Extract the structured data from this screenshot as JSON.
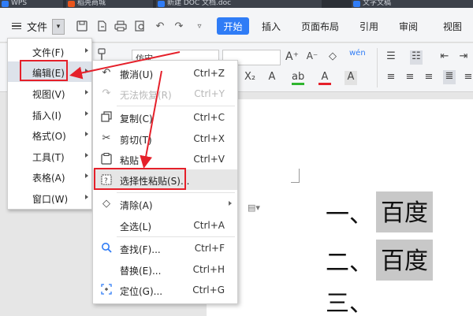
{
  "titlebar": {
    "tabs": [
      "WPS",
      "稻壳商城",
      "新建 DOC 文档.doc",
      "文字文稿"
    ]
  },
  "toolbar": {
    "file_label": "文件",
    "start_tab": "开始",
    "tabs": [
      "插入",
      "页面布局",
      "引用",
      "审阅",
      "视图"
    ]
  },
  "ribbon": {
    "font_name": "仿宋"
  },
  "file_menu": {
    "items": [
      {
        "label": "文件(F)",
        "has_arrow": true
      },
      {
        "label": "编辑(E)",
        "has_arrow": true
      },
      {
        "label": "视图(V)",
        "has_arrow": true
      },
      {
        "label": "插入(I)",
        "has_arrow": true
      },
      {
        "label": "格式(O)",
        "has_arrow": true
      },
      {
        "label": "工具(T)",
        "has_arrow": true
      },
      {
        "label": "表格(A)",
        "has_arrow": true
      },
      {
        "label": "窗口(W)",
        "has_arrow": true
      }
    ]
  },
  "edit_menu": {
    "items": [
      {
        "icon": "undo-icon",
        "label": "撤消(U)",
        "shortcut": "Ctrl+Z",
        "disabled": false
      },
      {
        "icon": "redo-icon",
        "label": "无法恢复(R)",
        "shortcut": "Ctrl+Y",
        "disabled": true
      },
      {
        "icon": "copy-icon",
        "label": "复制(C)",
        "shortcut": "Ctrl+C",
        "disabled": false
      },
      {
        "icon": "cut-icon",
        "label": "剪切(T)",
        "shortcut": "Ctrl+X",
        "disabled": false
      },
      {
        "icon": "paste-icon",
        "label": "粘贴",
        "shortcut": "Ctrl+V",
        "disabled": false
      },
      {
        "icon": "paste-special-icon",
        "label": "选择性粘贴(S)...",
        "shortcut": "",
        "disabled": false
      },
      {
        "icon": "eraser-icon",
        "label": "清除(A)",
        "shortcut": "",
        "disabled": false
      },
      {
        "icon": "",
        "label": "全选(L)",
        "shortcut": "Ctrl+A",
        "disabled": false
      },
      {
        "icon": "search-icon",
        "label": "查找(F)...",
        "shortcut": "Ctrl+F",
        "disabled": false
      },
      {
        "icon": "",
        "label": "替换(E)...",
        "shortcut": "Ctrl+H",
        "disabled": false
      },
      {
        "icon": "locate-icon",
        "label": "定位(G)...",
        "shortcut": "Ctrl+G",
        "disabled": false
      }
    ]
  },
  "document": {
    "lines": [
      {
        "number": "一、",
        "text": "百度"
      },
      {
        "number": "二、",
        "text": "百度"
      },
      {
        "number": "三、",
        "text": ""
      }
    ]
  },
  "colors": {
    "accent": "#2f7cf6",
    "highlight_box": "#e5202a",
    "selection": "#c8c8c8"
  }
}
